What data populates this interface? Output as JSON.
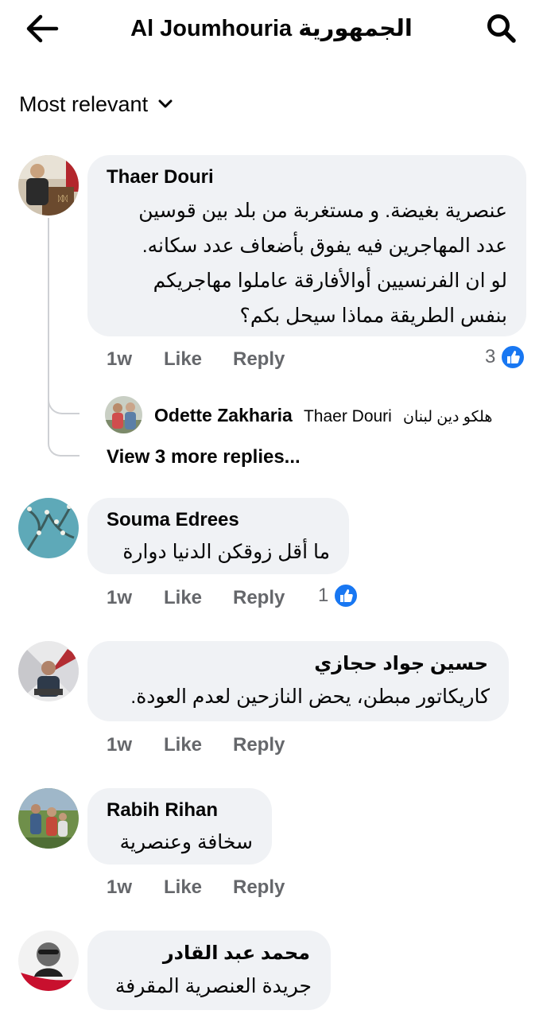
{
  "header": {
    "title": "Al Joumhouria الجمهورية",
    "back_icon": "arrow-left-icon",
    "search_icon": "search-icon"
  },
  "sort": {
    "label": "Most relevant",
    "icon": "chevron-down-icon"
  },
  "comments": [
    {
      "author": "Thaer Douri",
      "lines": [
        "عنصرية بغيضة. و مستغربة من بلد بين قوسين",
        "عدد المهاجرين فيه يفوق بأضعاف عدد سكانه.",
        "لو ان الفرنسيين أوالأفارقة عاملوا مهاجريكم",
        "بنفس الطريقة مماذا سيحل بكم؟"
      ],
      "time": "1w",
      "like": "Like",
      "reply": "Reply",
      "reactions": "3",
      "reply_preview": {
        "author": "Odette Zakharia",
        "mention": "Thaer Douri",
        "text": "هلكو دين لبنان"
      },
      "more_replies": "View 3 more replies..."
    },
    {
      "author": "Souma Edrees",
      "lines": [
        "ما أقل زوقكن الدنيا دوارة"
      ],
      "time": "1w",
      "like": "Like",
      "reply": "Reply",
      "reactions": "1"
    },
    {
      "author": "حسين جواد حجازي",
      "lines": [
        "كاريكاتور مبطن، يحض النازحين لعدم العودة."
      ],
      "time": "1w",
      "like": "Like",
      "reply": "Reply"
    },
    {
      "author": "Rabih Rihan",
      "lines": [
        "سخافة وعنصرية"
      ],
      "time": "1w",
      "like": "Like",
      "reply": "Reply"
    },
    {
      "author": "محمد عبد القادر",
      "lines": [
        "جريدة العنصرية المقرفة"
      ]
    }
  ],
  "colors": {
    "bubble": "#f0f2f5",
    "secondary_text": "#65676b",
    "like_blue": "#1877f2"
  }
}
